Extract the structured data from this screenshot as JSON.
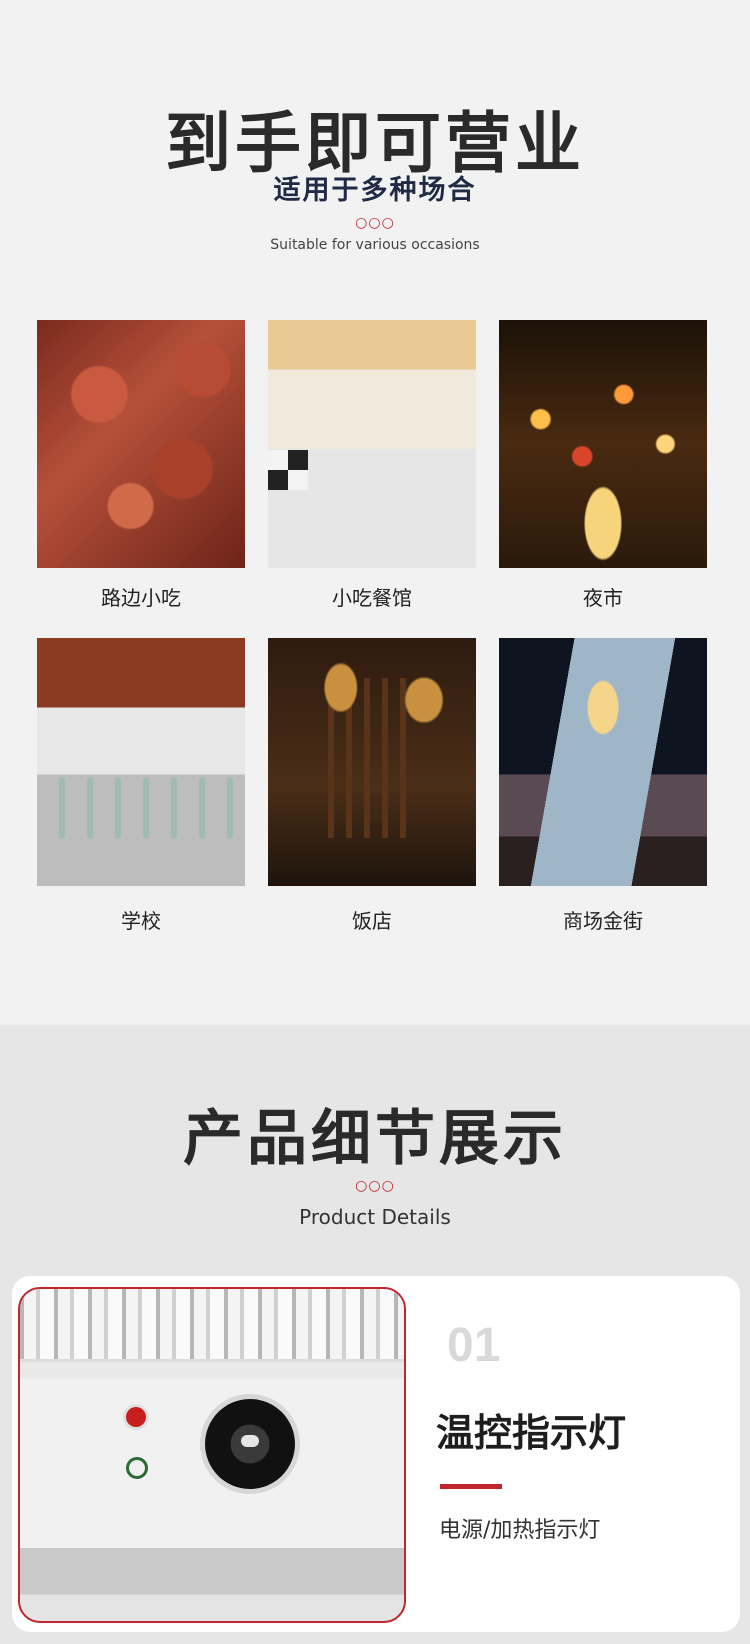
{
  "section1": {
    "title": "到手即可营业",
    "subtitle": "适用于多种场合",
    "dots": "○○○",
    "english": "Suitable for various occasions",
    "items": [
      {
        "label": "路边小吃"
      },
      {
        "label": "小吃餐馆"
      },
      {
        "label": "夜市"
      },
      {
        "label": "学校"
      },
      {
        "label": "饭店"
      },
      {
        "label": "商场金街"
      }
    ]
  },
  "section2": {
    "title": "产品细节展示",
    "dots": "○○○",
    "english": "Product Details",
    "feature": {
      "number": "01",
      "name": "温控指示灯",
      "description": "电源/加热指示灯"
    }
  },
  "colors": {
    "accent": "#c0262d"
  }
}
